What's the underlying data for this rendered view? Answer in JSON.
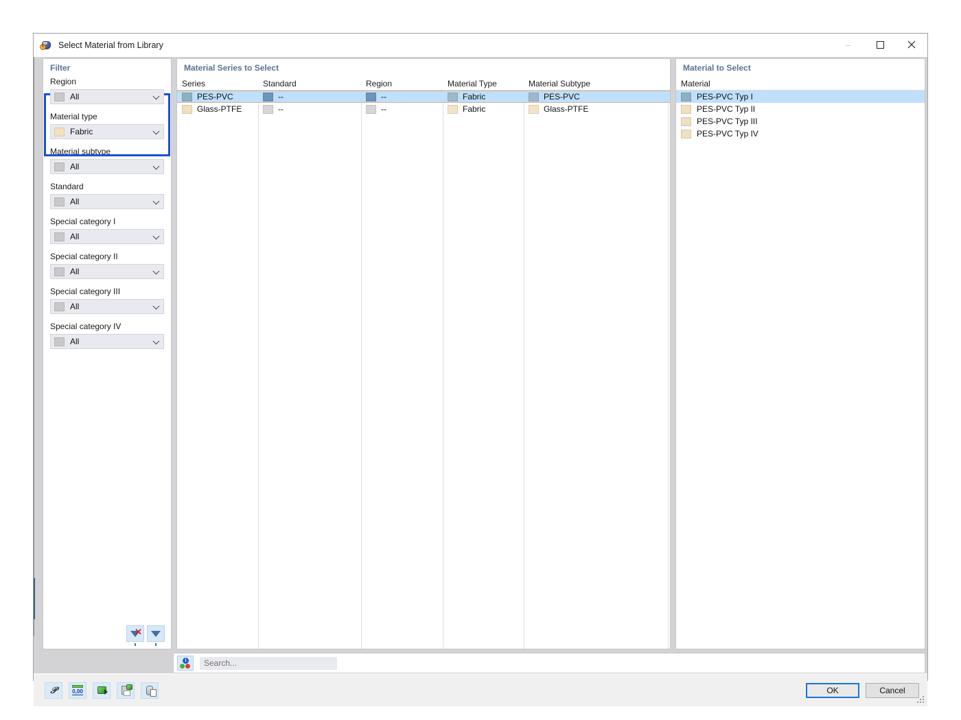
{
  "window": {
    "title": "Select Material from Library",
    "icon": "library-material-icon",
    "minimize": "–",
    "maximize": "❐",
    "close": "✕"
  },
  "filter_panel": {
    "title": "Filter",
    "groups": [
      {
        "label": "Region",
        "value": "All",
        "swatch": "#c9c9c9",
        "highlighted": true
      },
      {
        "label": "Material type",
        "value": "Fabric",
        "swatch": "#f3e0c0",
        "highlighted": true
      },
      {
        "label": "Material subtype",
        "value": "All",
        "swatch": "#c9c9c9",
        "highlighted": false
      },
      {
        "label": "Standard",
        "value": "All",
        "swatch": "#c9c9c9",
        "highlighted": false
      },
      {
        "label": "Special category I",
        "value": "All",
        "swatch": "#c9c9c9",
        "highlighted": false
      },
      {
        "label": "Special category II",
        "value": "All",
        "swatch": "#c9c9c9",
        "highlighted": false
      },
      {
        "label": "Special category III",
        "value": "All",
        "swatch": "#c9c9c9",
        "highlighted": false
      },
      {
        "label": "Special category IV",
        "value": "All",
        "swatch": "#c9c9c9",
        "highlighted": false
      }
    ],
    "actions": [
      {
        "name": "clear-filter-button",
        "icon": "funnel-clear-icon"
      },
      {
        "name": "apply-filter-button",
        "icon": "funnel-icon"
      }
    ]
  },
  "series_panel": {
    "title": "Material Series to Select",
    "columns": [
      "Series",
      "Standard",
      "Region",
      "Material Type",
      "Material Subtype"
    ],
    "rows": [
      {
        "selected": true,
        "swatch": "#8fb0c0",
        "cells": [
          "PES-PVC",
          "--",
          "--",
          "Fabric",
          "PES-PVC"
        ],
        "cell_swatches": [
          "#8fb0c0",
          "#6d94bb",
          "#6d94bb",
          "#9fb7c9",
          "#9fb7c9"
        ]
      },
      {
        "selected": false,
        "swatch": "#f0dfc0",
        "cells": [
          "Glass-PTFE",
          "--",
          "--",
          "Fabric",
          "Glass-PTFE"
        ],
        "cell_swatches": [
          "#f0dfc0",
          "#d6d6d6",
          "#d6d6d6",
          "#f3e4c8",
          "#f3e4c8"
        ]
      }
    ]
  },
  "material_panel": {
    "title": "Material to Select",
    "column": "Material",
    "rows": [
      {
        "label": "PES-PVC Typ I",
        "swatch": "#8fb0c0",
        "selected": true
      },
      {
        "label": "PES-PVC Typ II",
        "swatch": "#f0dfc0",
        "selected": false
      },
      {
        "label": "PES-PVC Typ III",
        "swatch": "#f0dfc0",
        "selected": false
      },
      {
        "label": "PES-PVC Typ IV",
        "swatch": "#f0dfc0",
        "selected": false
      }
    ]
  },
  "search": {
    "icon": "color-filter-search-icon",
    "badge": "i",
    "placeholder": "Search...",
    "value": ""
  },
  "footer": {
    "icons": [
      {
        "name": "info-help-icon",
        "glyph": "help"
      },
      {
        "name": "number-format-icon",
        "glyph": "0,00"
      },
      {
        "name": "export-material-icon",
        "glyph": "export"
      },
      {
        "name": "save-material-icon",
        "glyph": "save"
      },
      {
        "name": "database-import-icon",
        "glyph": "database"
      }
    ],
    "ok_label": "OK",
    "cancel_label": "Cancel"
  },
  "colors": {
    "panel_title": "#5a7391",
    "selection": "#bfdffa",
    "focus_border": "#1a4fd6",
    "dotted_marker": "#e08a3c"
  }
}
